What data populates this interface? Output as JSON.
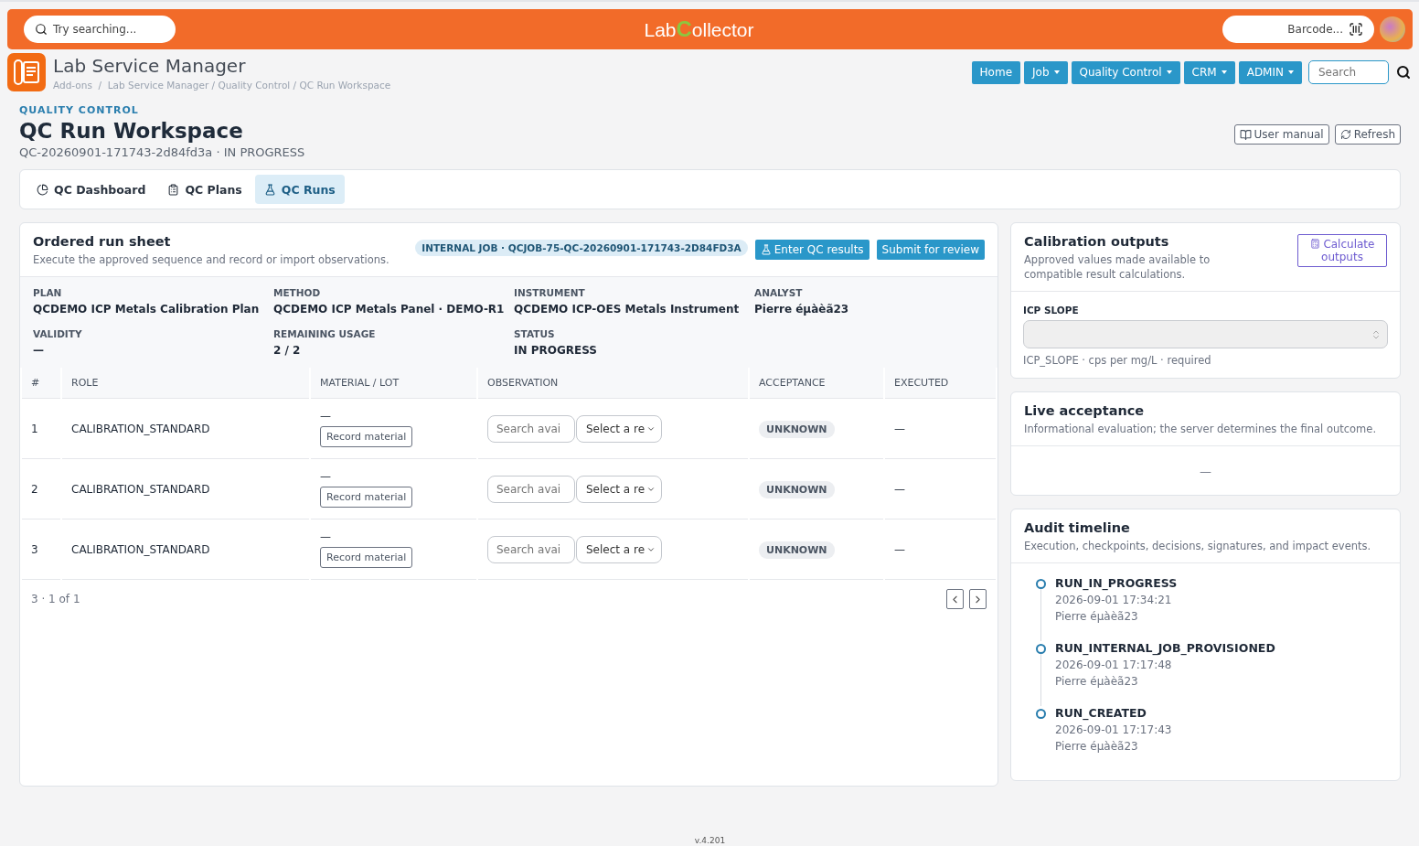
{
  "topbar": {
    "search": {
      "placeholder": "Try searching..."
    },
    "logo": [
      "Lab",
      "C",
      "ollector"
    ],
    "barcode": {
      "placeholder": "Barcode..."
    }
  },
  "app": {
    "title": "Lab Service Manager",
    "breadcrumb": "Add-ons  /  Lab Service Manager / Quality Control / QC Run Workspace"
  },
  "nav": {
    "items": [
      {
        "label": "Home",
        "dropdown": false
      },
      {
        "label": "Job",
        "dropdown": true
      },
      {
        "label": "Quality Control",
        "dropdown": true
      },
      {
        "label": "CRM",
        "dropdown": true
      },
      {
        "label": "ADMIN",
        "dropdown": true
      }
    ],
    "search": {
      "placeholder": "Search"
    }
  },
  "page": {
    "eyebrow": "QUALITY CONTROL",
    "title": "QC Run Workspace",
    "subtitle": "QC-20260901-171743-2d84fd3a · IN PROGRESS",
    "buttons": [
      {
        "kind": "manual",
        "label": "User manual"
      },
      {
        "kind": "refresh",
        "label": "Refresh"
      }
    ]
  },
  "tabs": [
    {
      "kind": "dashboard",
      "label": "QC Dashboard",
      "selected": false
    },
    {
      "kind": "plans",
      "label": "QC Plans",
      "selected": false
    },
    {
      "kind": "runs",
      "label": "QC Runs",
      "selected": true
    }
  ],
  "run_sheet": {
    "title": "Ordered run sheet",
    "subtitle": "Execute the approved sequence and record or import observations.",
    "job_badge": "INTERNAL JOB · QCJOB-75-QC-20260901-171743-2D84FD3A",
    "buttons": [
      {
        "kind": "enter",
        "label": "Enter QC results"
      },
      {
        "kind": "submit",
        "label": "Submit for review"
      }
    ],
    "facts": [
      {
        "label": "PLAN",
        "value": "QCDEMO ICP Metals Calibration Plan"
      },
      {
        "label": "METHOD",
        "value": "QCDEMO ICP Metals Panel · DEMO-R1"
      },
      {
        "label": "INSTRUMENT",
        "value": "QCDEMO ICP-OES Metals Instrument"
      },
      {
        "label": "ANALYST",
        "value": "Pierre éµàèã23"
      },
      {
        "label": "VALIDITY",
        "value": "—"
      },
      {
        "label": "REMAINING USAGE",
        "value": "2 / 2"
      },
      {
        "label": "STATUS",
        "value": "IN PROGRESS"
      }
    ],
    "table": {
      "columns": [
        "#",
        "ROLE",
        "MATERIAL / LOT",
        "OBSERVATION",
        "ACCEPTANCE",
        "EXECUTED"
      ],
      "rows": [
        {
          "index": "1",
          "role": "CALIBRATION_STANDARD",
          "material": "—",
          "record_button": "Record material",
          "search_placeholder": "Search avai",
          "select": "Select a re",
          "acceptance": "UNKNOWN",
          "executed": "—"
        },
        {
          "index": "2",
          "role": "CALIBRATION_STANDARD",
          "material": "—",
          "record_button": "Record material",
          "search_placeholder": "Search avai",
          "select": "Select a re",
          "acceptance": "UNKNOWN",
          "executed": "—"
        },
        {
          "index": "3",
          "role": "CALIBRATION_STANDARD",
          "material": "—",
          "record_button": "Record material",
          "search_placeholder": "Search avai",
          "select": "Select a re",
          "acceptance": "UNKNOWN",
          "executed": "—"
        }
      ]
    },
    "pagination": "3 · 1 of 1"
  },
  "calibration": {
    "title": "Calibration outputs",
    "subtitle": "Approved values made available to compatible result calculations.",
    "button": "Calculate outputs",
    "field_label": "ICP SLOPE",
    "field_hint": "ICP_SLOPE · cps per mg/L · required"
  },
  "live_acceptance": {
    "title": "Live acceptance",
    "subtitle": "Informational evaluation; the server determines the final outcome.",
    "value": "—"
  },
  "audit": {
    "title": "Audit timeline",
    "subtitle": "Execution, checkpoints, decisions, signatures, and impact events.",
    "events": [
      {
        "event": "RUN_IN_PROGRESS",
        "time": "2026-09-01 17:34:21",
        "user": "Pierre éµàèã23"
      },
      {
        "event": "RUN_INTERNAL_JOB_PROVISIONED",
        "time": "2026-09-01 17:17:48",
        "user": "Pierre éµàèã23"
      },
      {
        "event": "RUN_CREATED",
        "time": "2026-09-01 17:17:43",
        "user": "Pierre éµàèã23"
      }
    ]
  },
  "footer": "v.4.201"
}
